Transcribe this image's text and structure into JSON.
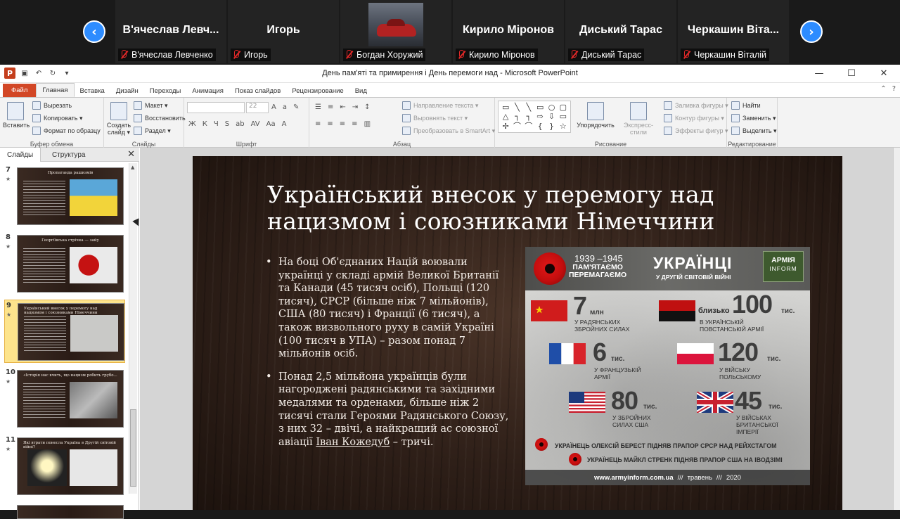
{
  "zoom": {
    "prev_arrow": "‹",
    "next_arrow": "›",
    "participants": [
      {
        "tile_name": "В'ячеслав Левч...",
        "label": "В'ячеслав Левченко"
      },
      {
        "tile_name": "Игорь",
        "label": "Игорь"
      },
      {
        "tile_name": "",
        "label": "Богдан Хоружий"
      },
      {
        "tile_name": "Кирило Міронов",
        "label": "Кирило Міронов"
      },
      {
        "tile_name": "Диський Тарас",
        "label": "Диський Тарас"
      },
      {
        "tile_name": "Черкашин Віта...",
        "label": "Черкашин Віталій"
      }
    ]
  },
  "window": {
    "title": "День пам'яті та примирення і День перемоги над  -  Microsoft PowerPoint",
    "app_icon": "P",
    "controls": {
      "minimize": "—",
      "maximize": "☐",
      "close": "✕"
    }
  },
  "ribbon_tabs": [
    "Файл",
    "Главная",
    "Вставка",
    "Дизайн",
    "Переходы",
    "Анимация",
    "Показ слайдов",
    "Рецензирование",
    "Вид"
  ],
  "ribbon": {
    "clipboard": {
      "label": "Буфер обмена",
      "paste": "Вставить",
      "cut": "Вырезать",
      "copy": "Копировать ▾",
      "format_painter": "Формат по образцу"
    },
    "slides": {
      "label": "Слайды",
      "new_slide": "Создать слайд ▾",
      "layout": "Макет ▾",
      "reset": "Восстановить",
      "section": "Раздел ▾"
    },
    "font": {
      "label": "Шрифт",
      "size": "22"
    },
    "paragraph": {
      "label": "Абзац",
      "direction": "Направление текста ▾",
      "align": "Выровнять текст ▾",
      "smartart": "Преобразовать в SmartArt ▾"
    },
    "drawing": {
      "label": "Рисование",
      "arrange": "Упорядочить",
      "quick_styles": "Экспресс-стили",
      "fill": "Заливка фигуры ▾",
      "outline": "Контур фигуры ▾",
      "effects": "Эффекты фигур ▾"
    },
    "editing": {
      "label": "Редактирование",
      "find": "Найти",
      "replace": "Заменить ▾",
      "select": "Выделить ▾"
    }
  },
  "pane": {
    "tab_slides": "Слайды",
    "tab_outline": "Структура",
    "close": "✕",
    "thumbnails": [
      {
        "num": "7",
        "title": "Пропаганда  рашизмів"
      },
      {
        "num": "8",
        "title": "Георгіївська стрічка — зайу"
      },
      {
        "num": "9",
        "title": "Український внесок у перемогу над нацизмом і союзниками Німеччини"
      },
      {
        "num": "10",
        "title": "«Історія нас вчить, що нацизм робить грубо..."
      },
      {
        "num": "11",
        "title": "Які втрати понесла Україна в Другій світовій війні?"
      }
    ]
  },
  "slide": {
    "title": "Український внесок у перемогу над нацизмом і союзниками Німеччини",
    "bullet1": "На боці Об'єднаних Націй воювали українці у складі армій Великої Британії та Канади (45 тисяч осіб), Польщі (120 тисяч), СРСР (більше ніж 7 мільйонів), США (80 тисяч) і Франції (6 тисяч), а також визвольного руху в самій Україні (100 тисяч в УПА) – разом понад 7 мільйонів осіб.",
    "bullet2_part1": "Понад 2,5 мільйона українців були нагороджені радянськими та західними медалями та орденами, більше ніж 2 тисячі стали Героями Радянського Союзу, з них 32 – двічі, а найкращий ас союзної авіації ",
    "bullet2_link": "Іван Кожедуб",
    "bullet2_part2": " – тричі."
  },
  "infographic": {
    "years": "1939 –1945",
    "slogan_line1": "ПАМ'ЯТАЄМО",
    "slogan_line2": "ПЕРЕМАГАЄМО",
    "heading": "УКРАЇНЦІ",
    "heading_sub": "У ДРУГІЙ СВІТОВІЙ ВІЙНІ",
    "logo_line1": "АРМІЯ",
    "logo_line2": "INFORM",
    "stats": [
      {
        "prefix": "",
        "value": "7",
        "unit": "млн",
        "label": "У радянських збройних силах"
      },
      {
        "prefix": "близько",
        "value": "100",
        "unit": "тис.",
        "label": "В Українській повстанській армії"
      },
      {
        "prefix": "",
        "value": "6",
        "unit": "тис.",
        "label": "У французькій армії"
      },
      {
        "prefix": "",
        "value": "120",
        "unit": "тис.",
        "label": "У війську польському"
      },
      {
        "prefix": "",
        "value": "80",
        "unit": "тис.",
        "label": "У збройних силах США"
      },
      {
        "prefix": "",
        "value": "45",
        "unit": "тис.",
        "label": "У військах Британської імперії"
      }
    ],
    "fact1": "Українець Олексій Берест підняв прапор СРСР над Рейхстагом",
    "fact2": "Українець Майкл Стренк підняв прапор США на Іводзімі",
    "footer_url": "www.armyinform.com.ua",
    "footer_sep": "///",
    "footer_month": "травень",
    "footer_year": "2020"
  },
  "colors": {
    "zoom_blue": "#2D8CFF",
    "file_tab": "#D24726",
    "poppy_red": "#C40E0E",
    "thumb_selected": "#FDE48C"
  }
}
